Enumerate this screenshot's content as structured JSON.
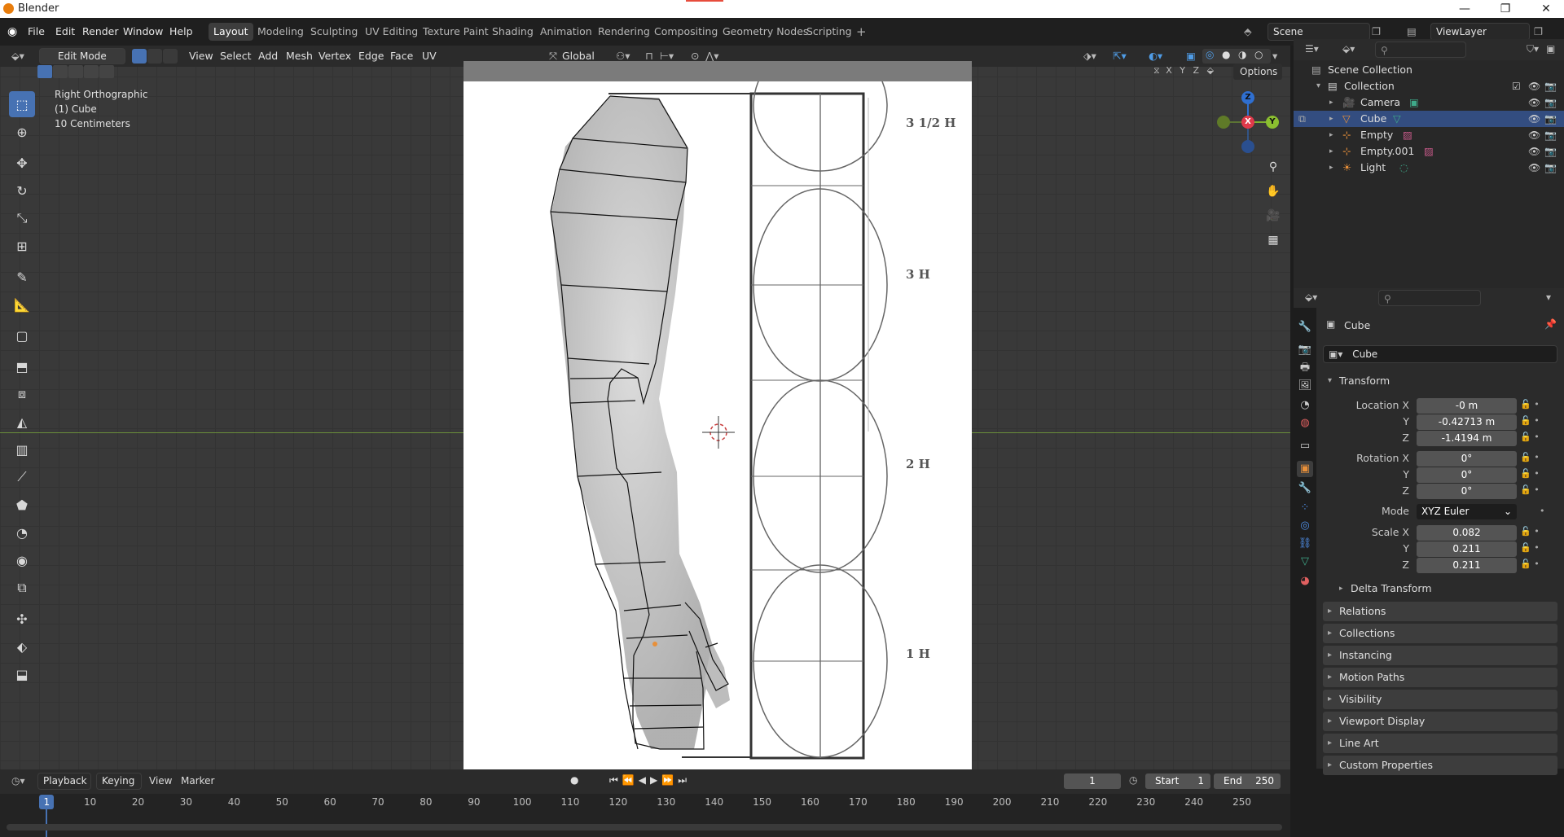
{
  "titlebar": {
    "title": "Blender"
  },
  "menu": [
    "File",
    "Edit",
    "Render",
    "Window",
    "Help"
  ],
  "workspaces": [
    "Layout",
    "Modeling",
    "Sculpting",
    "UV Editing",
    "Texture Paint",
    "Shading",
    "Animation",
    "Rendering",
    "Compositing",
    "Geometry Nodes",
    "Scripting"
  ],
  "scene": {
    "name": "Scene",
    "view_layer": "ViewLayer"
  },
  "viewport_header": {
    "mode": "Edit Mode",
    "menus": [
      "View",
      "Select",
      "Add",
      "Mesh",
      "Vertex",
      "Edge",
      "Face",
      "UV"
    ],
    "orientation": "Global",
    "options_label": "Options",
    "axes": [
      "X",
      "Y",
      "Z"
    ]
  },
  "viewport_overlay": {
    "view_name": "Right Orthographic",
    "object_name": "(1) Cube",
    "scale": "10 Centimeters"
  },
  "gizmo": {
    "z": "Z",
    "x": "X",
    "y": "Y"
  },
  "reference_image": {
    "labels": [
      "3 1/2 H",
      "3 H",
      "2 H",
      "1 H"
    ]
  },
  "outliner": {
    "root": "Scene Collection",
    "collection": "Collection",
    "items": [
      {
        "name": "Camera",
        "selected": false,
        "color": "#e8903a"
      },
      {
        "name": "Cube",
        "selected": true,
        "color": "#e8903a"
      },
      {
        "name": "Empty",
        "selected": false,
        "color": "#e8903a"
      },
      {
        "name": "Empty.001",
        "selected": false,
        "color": "#e8903a"
      },
      {
        "name": "Light",
        "selected": false,
        "color": "#e8903a"
      }
    ]
  },
  "properties": {
    "object_name": "Cube",
    "data_name": "Cube",
    "transform_title": "Transform",
    "location_label": "Location X",
    "rotation_label": "Rotation X",
    "scale_label": "Scale X",
    "y_label": "Y",
    "z_label": "Z",
    "mode_label": "Mode",
    "location": [
      "-0 m",
      "-0.42713 m",
      "-1.4194 m"
    ],
    "rotation": [
      "0°",
      "0°",
      "0°"
    ],
    "mode": "XYZ Euler",
    "scale": [
      "0.082",
      "0.211",
      "0.211"
    ],
    "delta": "Delta Transform",
    "panels": [
      "Relations",
      "Collections",
      "Instancing",
      "Motion Paths",
      "Visibility",
      "Viewport Display",
      "Line Art",
      "Custom Properties"
    ]
  },
  "timeline": {
    "menus": [
      "Playback",
      "Keying",
      "View",
      "Marker"
    ],
    "current_frame": "1",
    "start_label": "Start",
    "start": "1",
    "end_label": "End",
    "end": "250",
    "ticks": [
      "1",
      "10",
      "20",
      "30",
      "40",
      "50",
      "60",
      "70",
      "80",
      "90",
      "100",
      "110",
      "120",
      "130",
      "140",
      "150",
      "160",
      "170",
      "180",
      "190",
      "200",
      "210",
      "220",
      "230",
      "240",
      "250"
    ]
  },
  "colors": {
    "accent": "#4772b3",
    "selection": "#334d80",
    "object_orange": "#e8903a"
  }
}
